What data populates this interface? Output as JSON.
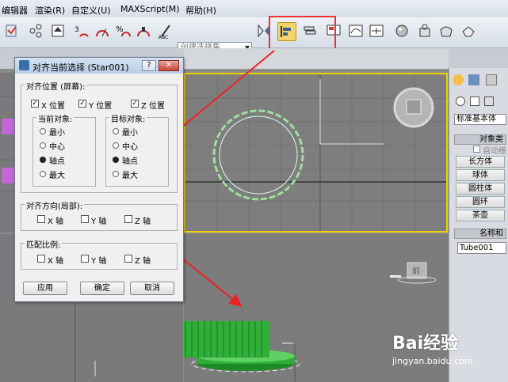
{
  "menu": [
    "编辑器",
    "渲染(R)",
    "自定义(U)",
    "MAXScript(M)",
    "帮助(H)"
  ],
  "toolbar": {
    "selection_set_placeholder": "创建选择集"
  },
  "dialog": {
    "title": "对齐当前选择 (Star001)",
    "help": "?",
    "close": "✕",
    "align_position": {
      "label": "对齐位置 (屏幕):",
      "x": "X 位置",
      "y": "Y 位置",
      "z": "Z 位置",
      "x_checked": true,
      "y_checked": true,
      "z_checked": true
    },
    "current_object": {
      "label": "当前对象:",
      "options": [
        "最小",
        "中心",
        "轴点",
        "最大"
      ],
      "selected": 2
    },
    "target_object": {
      "label": "目标对象:",
      "options": [
        "最小",
        "中心",
        "轴点",
        "最大"
      ],
      "selected": 2
    },
    "align_orientation": {
      "label": "对齐方向(局部):",
      "x": "X 轴",
      "y": "Y 轴",
      "z": "Z 轴"
    },
    "match_scale": {
      "label": "匹配比例:",
      "x": "X 轴",
      "y": "Y 轴",
      "z": "Z 轴"
    },
    "buttons": {
      "apply": "应用",
      "ok": "确定",
      "cancel": "取消"
    }
  },
  "command_panel": {
    "dropdown": "标准基本体",
    "object_type_header": "对象类",
    "autogrid": "自动栅",
    "buttons": [
      "长方体",
      "球体",
      "圆柱体",
      "圆环",
      "茶壶"
    ],
    "name_header": "名称和",
    "name_value": "Tube001"
  },
  "viewcube": {
    "front_label": "前"
  },
  "watermark": {
    "logo": "Bai经验",
    "url": "jingyan.baidu.com"
  },
  "colors": {
    "highlight": "#e33333",
    "viewport_active": "#f0d000",
    "object_green": "#2fae3a"
  }
}
